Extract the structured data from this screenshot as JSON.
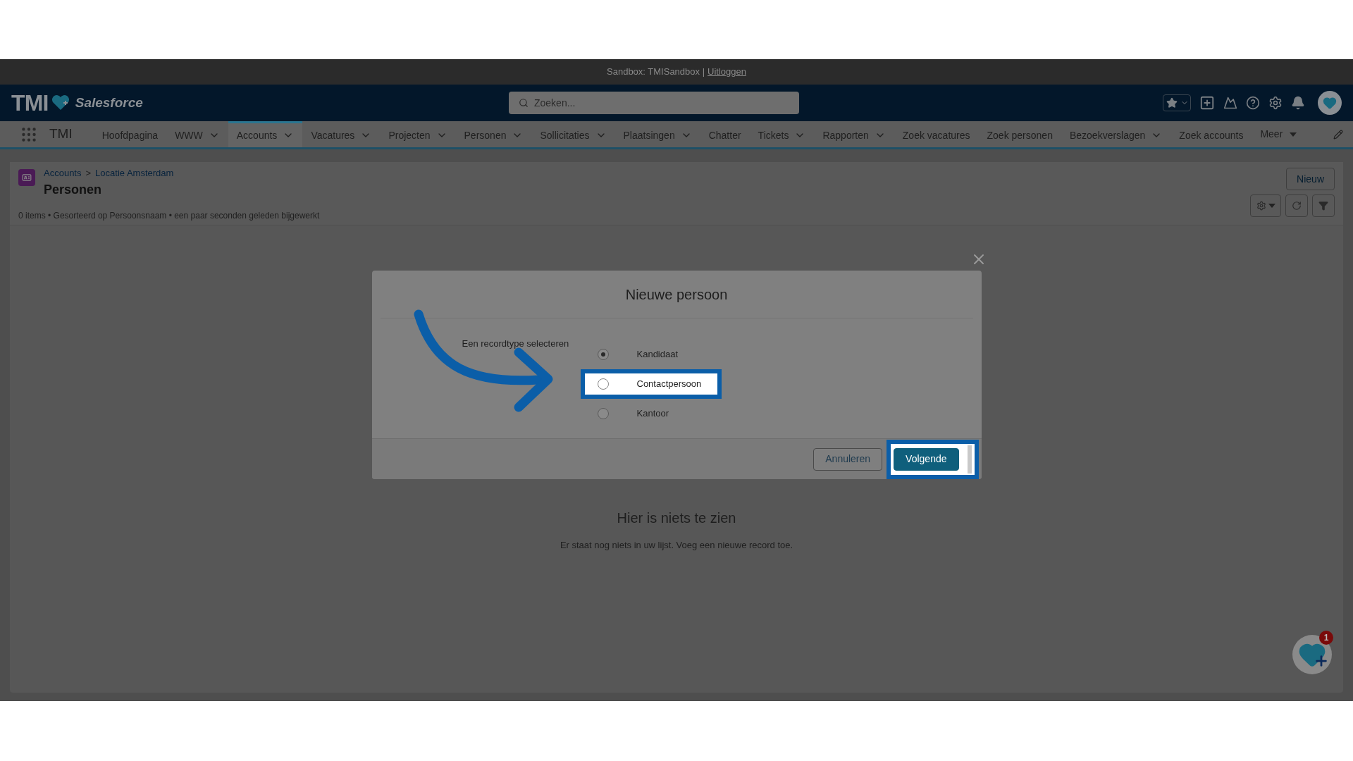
{
  "sandbox_bar": {
    "text": "Sandbox: TMISandbox |",
    "link": "Uitloggen"
  },
  "header": {
    "logo_text": "TMI",
    "brand": "Salesforce",
    "search": {
      "placeholder": "Zoeken..."
    }
  },
  "nav": {
    "app_name": "TMI",
    "items": [
      {
        "label": "Hoofdpagina",
        "has_menu": false,
        "selected": false
      },
      {
        "label": "WWW",
        "has_menu": true,
        "selected": false
      },
      {
        "label": "Accounts",
        "has_menu": true,
        "selected": true
      },
      {
        "label": "Vacatures",
        "has_menu": true,
        "selected": false
      },
      {
        "label": "Projecten",
        "has_menu": true,
        "selected": false
      },
      {
        "label": "Personen",
        "has_menu": true,
        "selected": false
      },
      {
        "label": "Sollicitaties",
        "has_menu": true,
        "selected": false
      },
      {
        "label": "Plaatsingen",
        "has_menu": true,
        "selected": false
      },
      {
        "label": "Chatter",
        "has_menu": false,
        "selected": false
      },
      {
        "label": "Tickets",
        "has_menu": true,
        "selected": false
      },
      {
        "label": "Rapporten",
        "has_menu": true,
        "selected": false
      },
      {
        "label": "Zoek vacatures",
        "has_menu": false,
        "selected": false
      },
      {
        "label": "Zoek personen",
        "has_menu": false,
        "selected": false
      },
      {
        "label": "Bezoekverslagen",
        "has_menu": true,
        "selected": false
      },
      {
        "label": "Zoek accounts",
        "has_menu": false,
        "selected": false
      }
    ],
    "more": "Meer"
  },
  "page": {
    "breadcrumb": [
      "Accounts",
      "Locatie Amsterdam"
    ],
    "separator": ">",
    "title": "Personen",
    "meta": "0 items • Gesorteerd op Persoonsnaam • een paar seconden geleden bijgewerkt",
    "new_button": "Nieuw"
  },
  "modal": {
    "title": "Nieuwe persoon",
    "label": "Een recordtype selecteren",
    "options": [
      {
        "label": "Kandidaat",
        "selected": true,
        "highlighted": false
      },
      {
        "label": "Contactpersoon",
        "selected": false,
        "highlighted": true
      },
      {
        "label": "Kantoor",
        "selected": false,
        "highlighted": false
      }
    ],
    "buttons": [
      {
        "label": "Annuleren",
        "kind": "neutral",
        "highlighted": false
      },
      {
        "label": "Volgende",
        "kind": "brand",
        "highlighted": true
      }
    ]
  },
  "empty_state": {
    "title": "Hier is niets te zien",
    "text": "Er staat nog niets in uw lijst. Voeg een nieuwe record toe."
  },
  "assistant": {
    "badge": "1"
  }
}
